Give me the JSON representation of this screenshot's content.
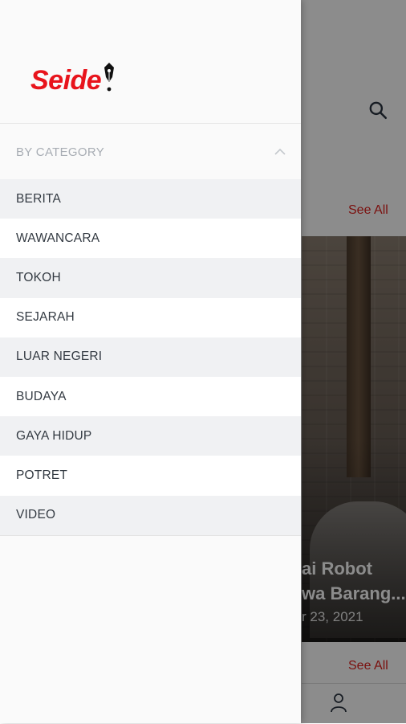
{
  "drawer": {
    "brand": "Seide",
    "section_title": "BY CATEGORY",
    "categories": [
      {
        "label": "BERITA"
      },
      {
        "label": "WAWANCARA"
      },
      {
        "label": "TOKOH"
      },
      {
        "label": "SEJARAH"
      },
      {
        "label": "LUAR NEGERI"
      },
      {
        "label": "BUDAYA"
      },
      {
        "label": "GAYA HIDUP"
      },
      {
        "label": "POTRET"
      },
      {
        "label": "VIDEO"
      }
    ]
  },
  "background": {
    "see_all_top": "See All",
    "see_all_bottom": "See All",
    "featured_title_line1": "ai Robot",
    "featured_title_line2": "wa Barang...",
    "featured_date": "r 23, 2021"
  },
  "icons": {
    "search": "search-icon",
    "chevron": "chevron-up-icon",
    "user": "user-icon",
    "logo_pen": "fountain-pen-icon"
  },
  "colors": {
    "brand": "#e8141c",
    "see_all": "#e0201d",
    "category_text": "#333a42",
    "section_title": "#a8adb4"
  }
}
